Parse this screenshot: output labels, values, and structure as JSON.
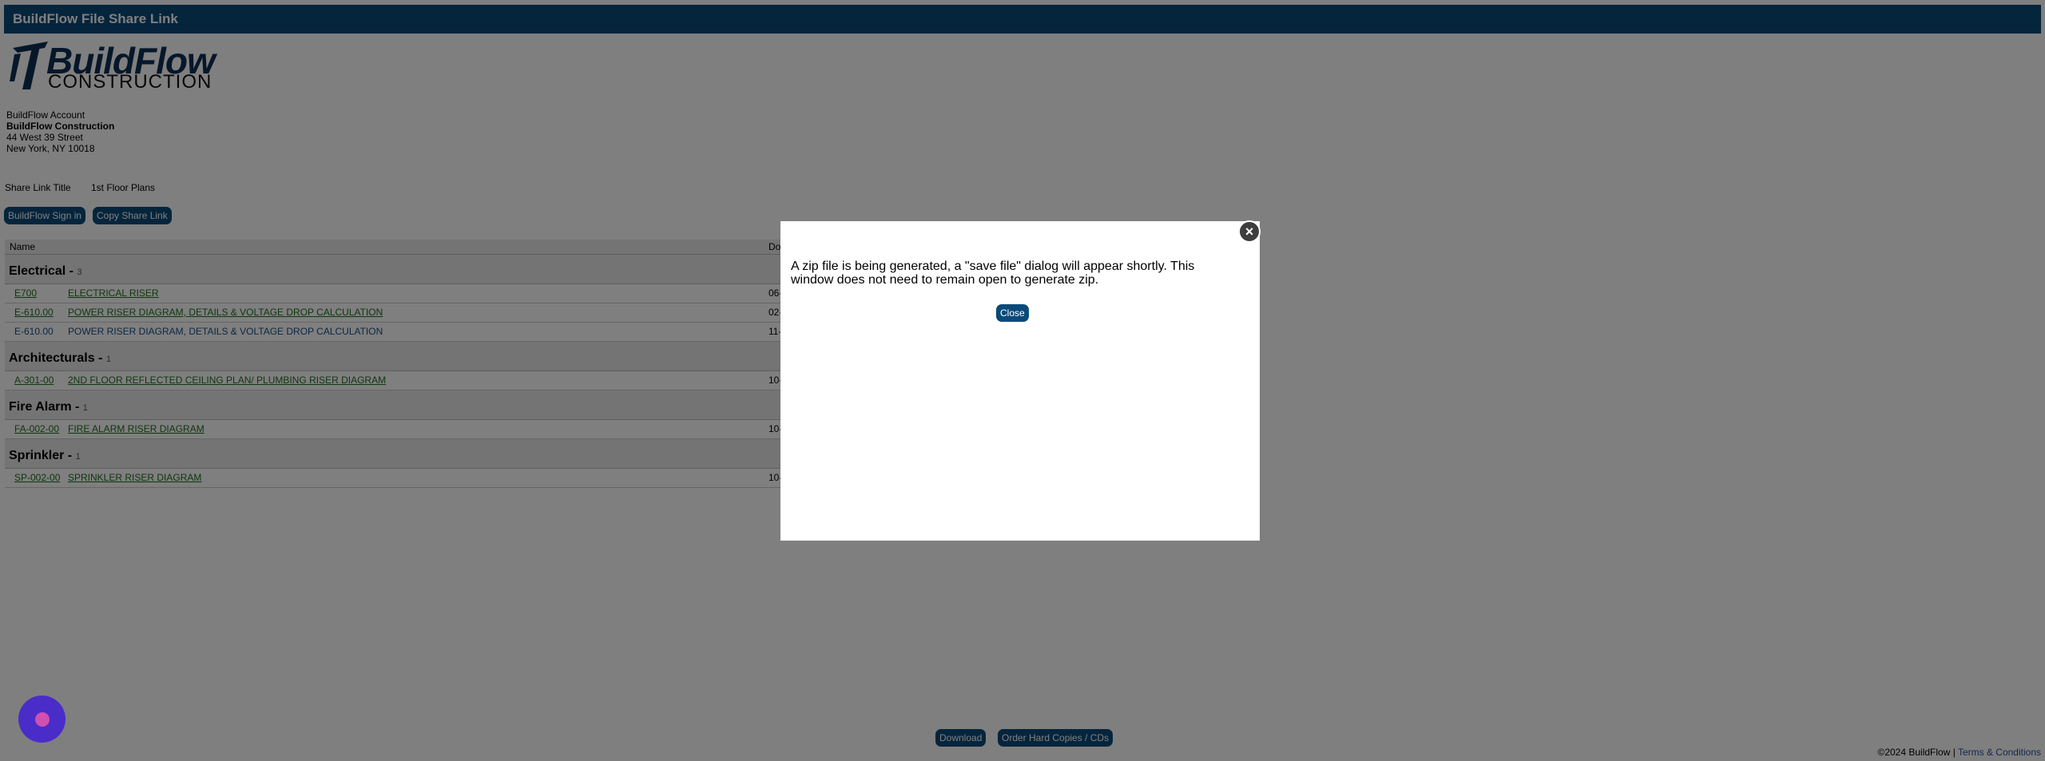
{
  "header": {
    "title": "BuildFlow File Share Link"
  },
  "logo": {
    "word1": "BuildFlow",
    "word2": "CONSTRUCTION"
  },
  "account": {
    "label": "BuildFlow Account",
    "company": "BuildFlow Construction",
    "street": "44 West 39 Street",
    "city": "New York, NY 10018"
  },
  "share_link": {
    "label": "Share Link Title",
    "value": "1st Floor Plans"
  },
  "actions": {
    "sign_in": "BuildFlow Sign in",
    "copy_link": "Copy Share Link"
  },
  "table": {
    "columns": {
      "name": "Name",
      "date": "Do"
    },
    "groups": [
      {
        "title": "Electrical - ",
        "count": "3",
        "rows": [
          {
            "code": "E700",
            "title": "ELECTRICAL RISER",
            "date": "06-",
            "linked": true
          },
          {
            "code": "E-610.00",
            "title": "POWER RISER DIAGRAM, DETAILS & VOLTAGE DROP CALCULATION",
            "date": "02-",
            "linked": true
          },
          {
            "code": "E-610.00",
            "title": "POWER RISER DIAGRAM, DETAILS & VOLTAGE DROP CALCULATION",
            "date": "11-",
            "linked": false
          }
        ]
      },
      {
        "title": "Architecturals - ",
        "count": "1",
        "rows": [
          {
            "code": "A-301-00",
            "title": "2ND FLOOR REFLECTED CEILING PLAN/ PLUMBING RISER DIAGRAM",
            "date": "10-",
            "linked": true
          }
        ]
      },
      {
        "title": "Fire Alarm - ",
        "count": "1",
        "rows": [
          {
            "code": "FA-002-00",
            "title": "FIRE ALARM RISER DIAGRAM",
            "date": "10-",
            "linked": true
          }
        ]
      },
      {
        "title": "Sprinkler - ",
        "count": "1",
        "rows": [
          {
            "code": "SP-002-00",
            "title": "SPRINKLER RISER DIAGRAM",
            "date": "10-",
            "linked": true
          }
        ]
      }
    ]
  },
  "modal": {
    "message": "A zip file is being generated, a \"save file\" dialog will appear shortly. This window does not need to remain open to generate zip.",
    "close_label": "Close",
    "close_icon": "close-icon"
  },
  "bottom": {
    "download": "Download",
    "order": "Order Hard Copies / CDs"
  },
  "footer": {
    "copyright": "©2024 BuildFlow | ",
    "terms": "Terms & Conditions"
  },
  "chat": {
    "icon": "chat-launcher-icon"
  },
  "colors": {
    "brand": "#0a4a7a",
    "link": "#1f6e1f",
    "overlay": "rgba(0,0,0,0.5)",
    "chat": "#4a2cc9"
  }
}
